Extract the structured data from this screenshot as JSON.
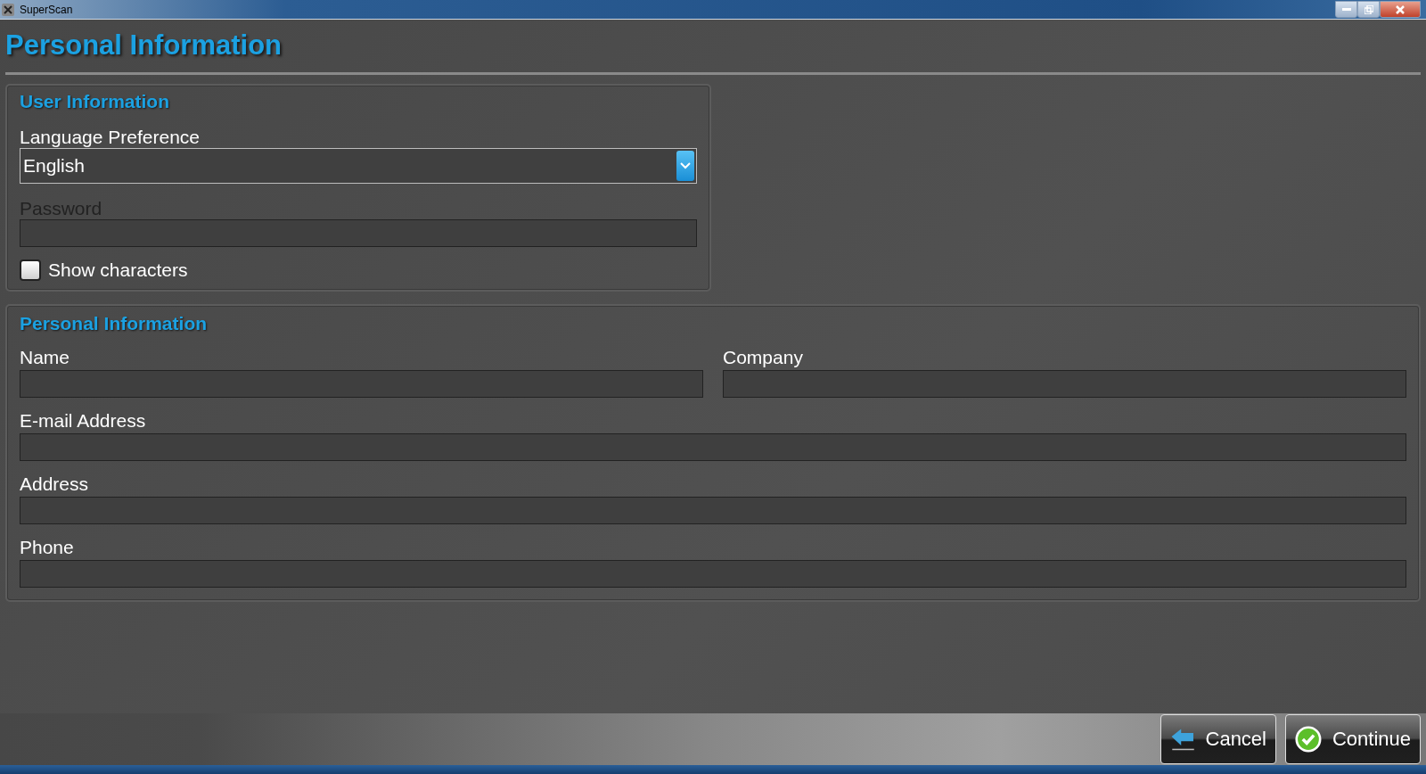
{
  "window": {
    "title": "SuperScan"
  },
  "page_title": "Personal Information",
  "user_information": {
    "heading": "User Information",
    "language": {
      "label": "Language Preference",
      "value": "English"
    },
    "password": {
      "label": "Password"
    },
    "show_characters": {
      "label": "Show characters",
      "checked": false
    }
  },
  "personal_information": {
    "heading": "Personal Information",
    "fields": [
      {
        "label": "Name",
        "kind": "half"
      },
      {
        "label": "Company",
        "kind": "half"
      },
      {
        "label": "E-mail Address",
        "kind": "full"
      },
      {
        "label": "Address",
        "kind": "full"
      },
      {
        "label": "Phone",
        "kind": "full"
      }
    ]
  },
  "buttons": [
    {
      "label": "Cancel",
      "kind": "back"
    },
    {
      "label": "Continue",
      "kind": "confirm"
    }
  ]
}
